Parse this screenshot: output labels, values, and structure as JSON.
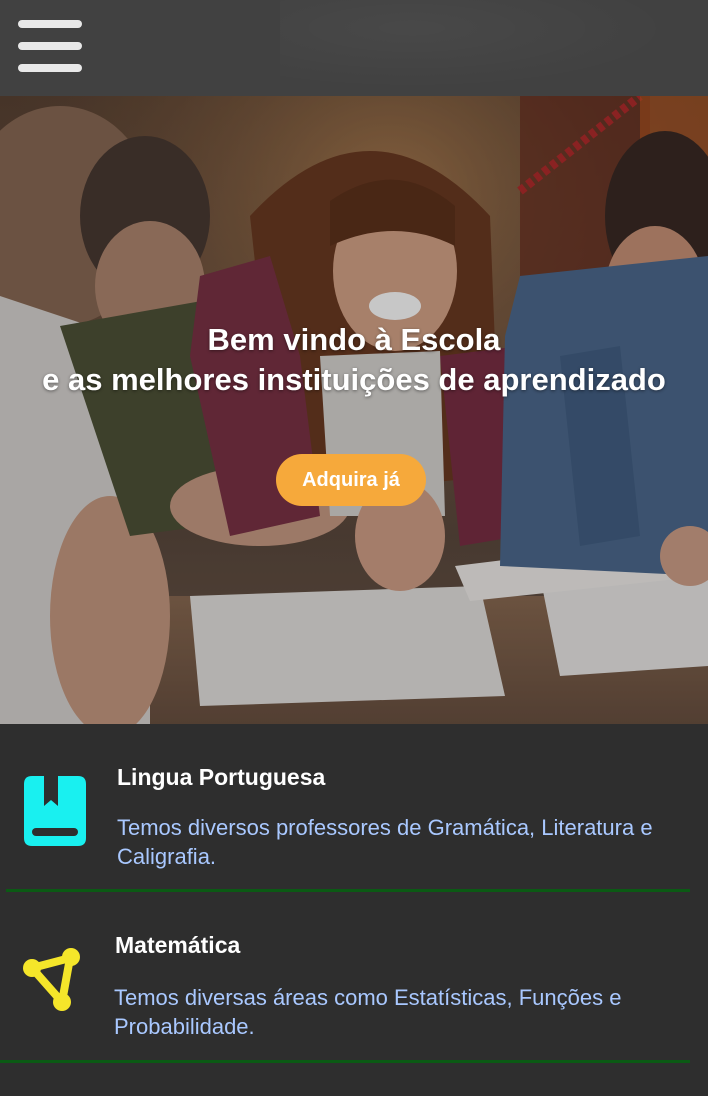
{
  "header": {
    "menu_icon": "hamburger-menu-icon"
  },
  "hero": {
    "title_line1": "Bem vindo à Escola",
    "title_line2": "e as melhores instituições de aprendizado",
    "cta_label": "Adquira já"
  },
  "subjects": [
    {
      "icon": "book-icon",
      "icon_color": "#19f0f0",
      "title": "Lingua Portuguesa",
      "description": "Temos diversos professores de Gramática, Literatura e Caligrafia."
    },
    {
      "icon": "triangle-nodes-icon",
      "icon_color": "#f5e62a",
      "title": "Matemática",
      "description": "Temos diversas áreas como Estatísticas, Funções e Probabilidade."
    }
  ],
  "colors": {
    "cta": "#f6a93b",
    "description_text": "#a9c8ff",
    "divider": "#0b5a14"
  }
}
